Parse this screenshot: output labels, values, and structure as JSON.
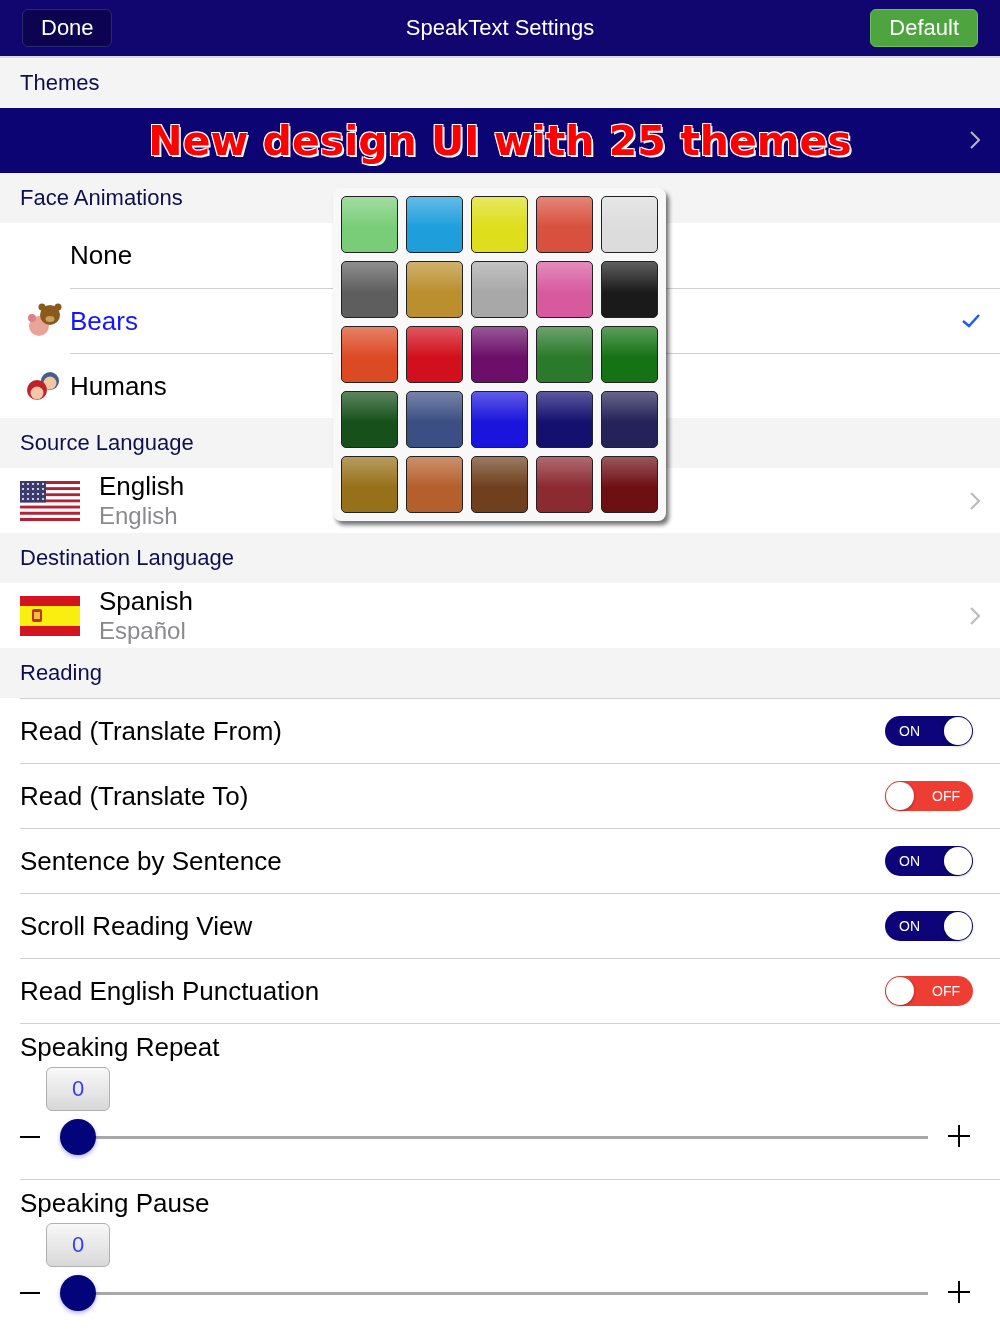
{
  "nav": {
    "title": "SpeakText Settings",
    "left_button": "Done",
    "right_button": "Default"
  },
  "themes": {
    "header": "Themes",
    "banner": "New design UI with 25 themes",
    "swatches": [
      {
        "color": "#7acd78"
      },
      {
        "color": "#1e9fdc"
      },
      {
        "color": "#dede1c"
      },
      {
        "color": "#d9503e"
      },
      {
        "color": "#dcdcdc"
      },
      {
        "color": "#5e5e5e"
      },
      {
        "color": "#bb8f2e"
      },
      {
        "color": "#a8a8a8"
      },
      {
        "color": "#d75a9f"
      },
      {
        "color": "#1a1a1a"
      },
      {
        "color": "#dc4a24"
      },
      {
        "color": "#d20f1c"
      },
      {
        "color": "#6c0f6a"
      },
      {
        "color": "#2b7a2b"
      },
      {
        "color": "#157315"
      },
      {
        "color": "#17501a"
      },
      {
        "color": "#3b4f84"
      },
      {
        "color": "#1a14dc"
      },
      {
        "color": "#141070"
      },
      {
        "color": "#242258"
      },
      {
        "color": "#97711a"
      },
      {
        "color": "#b45f2c"
      },
      {
        "color": "#70401e"
      },
      {
        "color": "#8c2a32"
      },
      {
        "color": "#6e0f14"
      }
    ]
  },
  "face_animations": {
    "header": "Face Animations",
    "options": [
      {
        "label": "None",
        "kind": "none",
        "selected": false
      },
      {
        "label": "Bears",
        "kind": "bears",
        "selected": true
      },
      {
        "label": "Humans",
        "kind": "humans",
        "selected": false
      }
    ]
  },
  "source_language": {
    "header": "Source Language",
    "name": "English",
    "native": "English",
    "kind": "us"
  },
  "destination_language": {
    "header": "Destination Language",
    "name": "Spanish",
    "native": "Español",
    "kind": "es"
  },
  "reading": {
    "header": "Reading",
    "toggles": [
      {
        "label": "Read (Translate From)",
        "on": true,
        "state_text": "ON"
      },
      {
        "label": "Read (Translate To)",
        "on": false,
        "state_text": "OFF"
      },
      {
        "label": "Sentence by Sentence",
        "on": true,
        "state_text": "ON"
      },
      {
        "label": "Scroll Reading View",
        "on": true,
        "state_text": "ON"
      },
      {
        "label": "Read English Punctuation",
        "on": false,
        "state_text": "OFF"
      }
    ],
    "sliders": [
      {
        "label": "Speaking Repeat",
        "value": "0",
        "level": 0
      },
      {
        "label": "Speaking Pause",
        "value": "0",
        "level": 0
      }
    ]
  }
}
